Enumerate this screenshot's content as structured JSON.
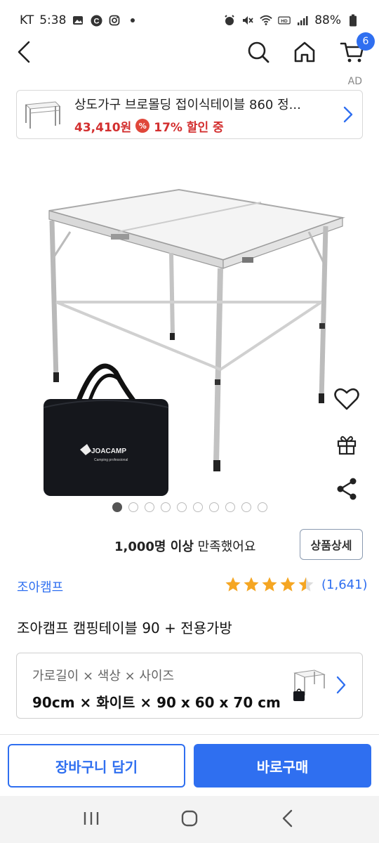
{
  "status_bar": {
    "carrier": "KT",
    "time": "5:38",
    "battery": "88%"
  },
  "header": {
    "cart_count": "6"
  },
  "ad": {
    "label": "AD",
    "title": "상도가구 브로몰딩 접이식테이블 860 정...",
    "price": "43,410원",
    "discount": "17% 할인 중",
    "discount_icon_text": "%"
  },
  "gallery": {
    "total_images": 10,
    "current_index": 0,
    "brand_logo": "JOACAMP",
    "brand_logo_sub": "Camping professional"
  },
  "satisfaction": {
    "bold": "1,000명 이상",
    "rest": " 만족했어요"
  },
  "detail_button": "상품상세",
  "brand": "조아캠프",
  "rating": {
    "score": 4.5,
    "max": 5,
    "count": "(1,641)"
  },
  "product_title": "조아캠프 캠핑테이블 90 + 전용가방",
  "option": {
    "label": "가로길이 × 색상 × 사이즈",
    "value": "90cm × 화이트 × 90 x 60 x 70 cm"
  },
  "buttons": {
    "cart": "장바구니 담기",
    "buy": "바로구매"
  },
  "colors": {
    "accent": "#2f6ff0",
    "price_red": "#d32f2f",
    "star": "#f5a623"
  }
}
